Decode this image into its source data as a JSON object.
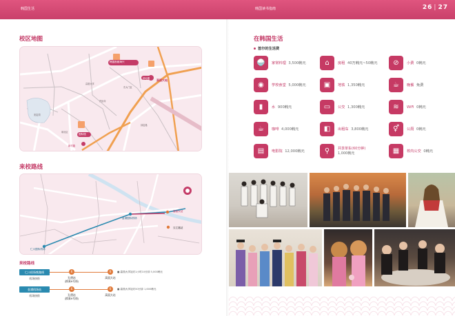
{
  "header": {
    "left_crumb": "韩国生活",
    "right_crumb": "韩国读书指南",
    "page_left": "26",
    "page_right": "27",
    "accent": "#d34a75"
  },
  "left": {
    "campus_map_title": "校区地图",
    "campus_map_labels": {
      "lotte": "韩国首都海兴",
      "station": "高丽大站",
      "lecture": "讲坛楼",
      "gate": "国际馆",
      "road": "新村路"
    },
    "route_title": "来校路线",
    "route_map_labels": {
      "airport": "仁川国际机场",
      "gimpo": "金浦国际机场",
      "school": "高丽大站",
      "seoul": "汉江路站"
    },
    "routes_heading": "来校路线",
    "routes": [
      {
        "from": "仁川机场铁路线",
        "mode": "机场快线",
        "transfer": "孔德站",
        "transfer_note": "(换乘6号线)",
        "to": "高丽大站",
        "summary": "■ 高丽大学站约1小时10分钟 5,000韩元"
      },
      {
        "from": "金浦机场站",
        "mode": "机场快线",
        "transfer": "孔德站",
        "transfer_note": "(换乘6号线)",
        "to": "高丽大站",
        "summary": "■ 高丽大学站约50分钟 1,600韩元"
      }
    ]
  },
  "right": {
    "section_title": "在韩国生活",
    "sub_title": "首尔的生活费",
    "costs": [
      {
        "icon": "rice-icon",
        "glyph": "🍚",
        "name": "家常料理",
        "value": "3,500韩元"
      },
      {
        "icon": "house-icon",
        "glyph": "⌂",
        "name": "房租",
        "value": "40万韩元~50韩元"
      },
      {
        "icon": "no-smoking-icon",
        "glyph": "⊘",
        "name": "小费",
        "value": "0韩元"
      },
      {
        "icon": "cafeteria-icon",
        "glyph": "◉",
        "name": "学校食堂",
        "value": "5,000韩元"
      },
      {
        "icon": "subway-icon",
        "glyph": "▣",
        "name": "地铁",
        "value": "1,350韩元"
      },
      {
        "icon": "takeout-icon",
        "glyph": "☕",
        "name": "晚餐",
        "value": "免费"
      },
      {
        "icon": "water-icon",
        "glyph": "▮",
        "name": "水",
        "value": "900韩元"
      },
      {
        "icon": "bus-icon",
        "glyph": "▭",
        "name": "公交",
        "value": "1,300韩元"
      },
      {
        "icon": "wifi-icon",
        "glyph": "≋",
        "name": "WiFi",
        "value": "0韩元"
      },
      {
        "icon": "coffee-icon",
        "glyph": "☕",
        "name": "咖啡",
        "value": "4,000韩元"
      },
      {
        "icon": "taxi-icon",
        "glyph": "◧",
        "name": "出租车",
        "value": "3,800韩元"
      },
      {
        "icon": "restroom-icon",
        "glyph": "⚥",
        "name": "公厕",
        "value": "0韩元"
      },
      {
        "icon": "cinema-icon",
        "glyph": "▤",
        "name": "电影院",
        "value": "12,000韩元"
      },
      {
        "icon": "bicycle-icon",
        "glyph": "⚲",
        "name": "共享单车(60分钟)",
        "value": "1,000韩元"
      },
      {
        "icon": "school-bus-icon",
        "glyph": "▦",
        "name": "校内公交",
        "value": "0韩元"
      }
    ]
  }
}
